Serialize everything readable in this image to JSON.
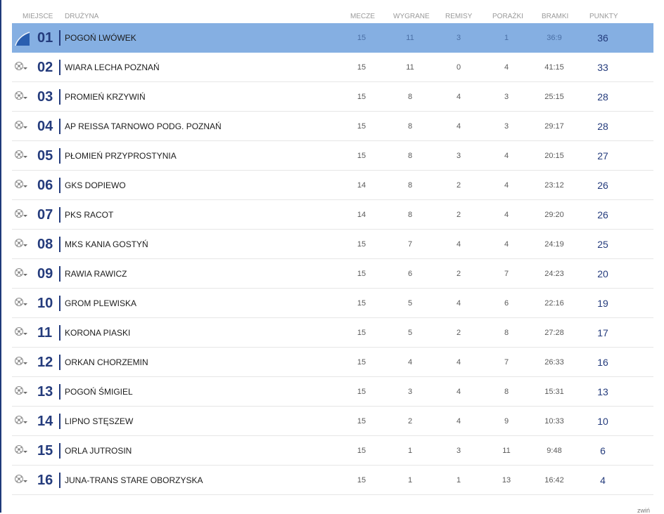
{
  "header": {
    "miejsce": "MIEJSCE",
    "druzyna": "DRUŻYNA",
    "mecze": "MECZE",
    "wygrane": "WYGRANE",
    "remisy": "REMISY",
    "porazki": "PORAŻKI",
    "bramki": "BRAMKI",
    "punkty": "PUNKTY"
  },
  "colors": {
    "highlight_row": "#85afe2",
    "position_text": "#243b7c"
  },
  "icons": {
    "leader": "promotion-arrow-icon",
    "row": "soccer-ball-dropdown-icon"
  },
  "rows": [
    {
      "pos": "01",
      "team": "POGOŃ LWÓWEK",
      "mecze": "15",
      "wygrane": "11",
      "remisy": "3",
      "porazki": "1",
      "bramki": "36:9",
      "punkty": "36"
    },
    {
      "pos": "02",
      "team": "WIARA LECHA POZNAŃ",
      "mecze": "15",
      "wygrane": "11",
      "remisy": "0",
      "porazki": "4",
      "bramki": "41:15",
      "punkty": "33"
    },
    {
      "pos": "03",
      "team": "PROMIEŃ KRZYWIŃ",
      "mecze": "15",
      "wygrane": "8",
      "remisy": "4",
      "porazki": "3",
      "bramki": "25:15",
      "punkty": "28"
    },
    {
      "pos": "04",
      "team": "AP REISSA TARNOWO PODG. POZNAŃ",
      "mecze": "15",
      "wygrane": "8",
      "remisy": "4",
      "porazki": "3",
      "bramki": "29:17",
      "punkty": "28"
    },
    {
      "pos": "05",
      "team": "PŁOMIEŃ PRZYPROSTYNIA",
      "mecze": "15",
      "wygrane": "8",
      "remisy": "3",
      "porazki": "4",
      "bramki": "20:15",
      "punkty": "27"
    },
    {
      "pos": "06",
      "team": "GKS DOPIEWO",
      "mecze": "14",
      "wygrane": "8",
      "remisy": "2",
      "porazki": "4",
      "bramki": "23:12",
      "punkty": "26"
    },
    {
      "pos": "07",
      "team": "PKS RACOT",
      "mecze": "14",
      "wygrane": "8",
      "remisy": "2",
      "porazki": "4",
      "bramki": "29:20",
      "punkty": "26"
    },
    {
      "pos": "08",
      "team": "MKS KANIA GOSTYŃ",
      "mecze": "15",
      "wygrane": "7",
      "remisy": "4",
      "porazki": "4",
      "bramki": "24:19",
      "punkty": "25"
    },
    {
      "pos": "09",
      "team": "RAWIA RAWICZ",
      "mecze": "15",
      "wygrane": "6",
      "remisy": "2",
      "porazki": "7",
      "bramki": "24:23",
      "punkty": "20"
    },
    {
      "pos": "10",
      "team": "GROM PLEWISKA",
      "mecze": "15",
      "wygrane": "5",
      "remisy": "4",
      "porazki": "6",
      "bramki": "22:16",
      "punkty": "19"
    },
    {
      "pos": "11",
      "team": "KORONA PIASKI",
      "mecze": "15",
      "wygrane": "5",
      "remisy": "2",
      "porazki": "8",
      "bramki": "27:28",
      "punkty": "17"
    },
    {
      "pos": "12",
      "team": "ORKAN CHORZEMIN",
      "mecze": "15",
      "wygrane": "4",
      "remisy": "4",
      "porazki": "7",
      "bramki": "26:33",
      "punkty": "16"
    },
    {
      "pos": "13",
      "team": "POGOŃ ŚMIGIEL",
      "mecze": "15",
      "wygrane": "3",
      "remisy": "4",
      "porazki": "8",
      "bramki": "15:31",
      "punkty": "13"
    },
    {
      "pos": "14",
      "team": "LIPNO STĘSZEW",
      "mecze": "15",
      "wygrane": "2",
      "remisy": "4",
      "porazki": "9",
      "bramki": "10:33",
      "punkty": "10"
    },
    {
      "pos": "15",
      "team": "ORLA JUTROSIN",
      "mecze": "15",
      "wygrane": "1",
      "remisy": "3",
      "porazki": "11",
      "bramki": "9:48",
      "punkty": "6"
    },
    {
      "pos": "16",
      "team": "JUNA-TRANS STARE OBORZYSKA",
      "mecze": "15",
      "wygrane": "1",
      "remisy": "1",
      "porazki": "13",
      "bramki": "16:42",
      "punkty": "4"
    }
  ],
  "footer": {
    "partial_text": "zwiń"
  }
}
